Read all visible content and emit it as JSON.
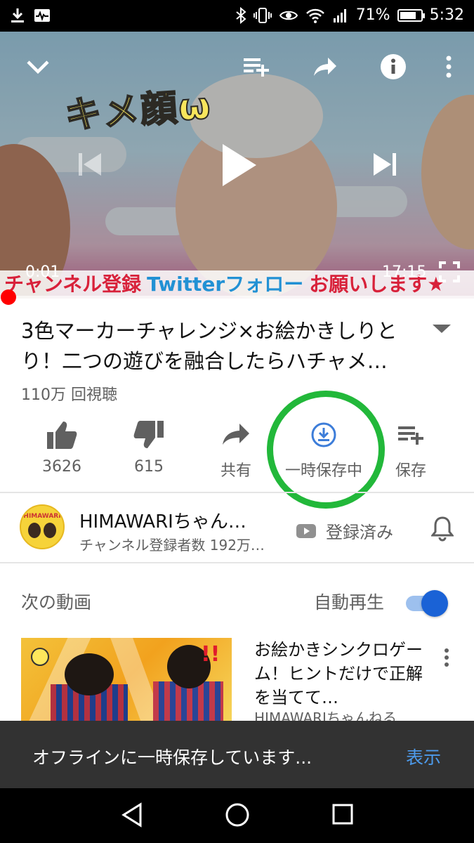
{
  "status_bar": {
    "battery": "71%",
    "time": "5:32"
  },
  "player": {
    "caption_top": "キメ顔ω",
    "caption_bottom": [
      "チャンネル登録",
      "Twitterフォロー",
      "お願いします★"
    ],
    "current_time": "0:01",
    "duration": "17:15",
    "progress": 0.001
  },
  "video": {
    "title": "3色マーカーチャレンジ×お絵かきしりとり！二つの遊びを融合したらハチャメ…",
    "views": "110万 回視聴"
  },
  "actions": [
    {
      "name": "like",
      "label": "3626"
    },
    {
      "name": "dislike",
      "label": "615"
    },
    {
      "name": "share",
      "label": "共有"
    },
    {
      "name": "offline",
      "label": "一時保存中"
    },
    {
      "name": "save",
      "label": "保存"
    }
  ],
  "channel": {
    "name": "HIMAWARIちゃん…",
    "subscribers": "チャンネル登録者数 192万…",
    "subscribe_label": "登録済み",
    "avatar_text": "HIMAWARI"
  },
  "up_next": {
    "label": "次の動画",
    "autoplay_label": "自動再生",
    "autoplay_on": true,
    "video": {
      "title": "お絵かきシンクロゲーム！ヒントだけで正解を当てて…",
      "channel": "HIMAWARIちゃんねる"
    }
  },
  "snackbar": {
    "message": "オフラインに一時保存しています...",
    "action": "表示"
  },
  "colors": {
    "accent_blue": "#1a62d6",
    "download_blue": "#3d7dd9",
    "highlight_green": "#22b83a",
    "progress_red": "#ff0000",
    "snackbar_action": "#4d9bec"
  }
}
